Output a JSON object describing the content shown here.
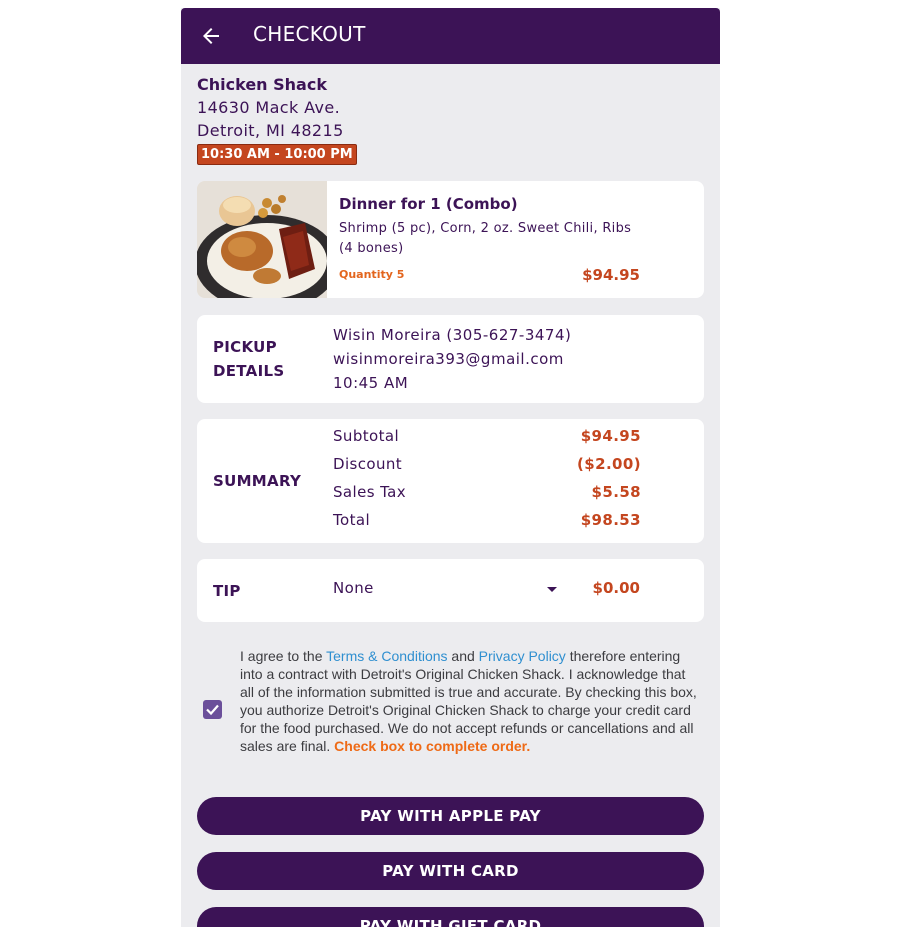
{
  "header": {
    "title": "CHECKOUT",
    "back_icon": "arrow-left-icon"
  },
  "store": {
    "name": "Chicken Shack",
    "address1": "14630 Mack Ave.",
    "address2": "Detroit, MI 48215",
    "hours": "10:30 AM - 10:00 PM"
  },
  "item": {
    "name": "Dinner for 1 (Combo)",
    "description": "Shrimp (5 pc), Corn, 2 oz. Sweet Chili, Ribs (4 bones)",
    "quantity": "Quantity 5",
    "price": "$94.95"
  },
  "pickup": {
    "label_line1": "PICKUP",
    "label_line2": "DETAILS",
    "name_phone": "Wisin Moreira (305-627-3474)",
    "email": "wisinmoreira393@gmail.com",
    "time": "10:45 AM"
  },
  "summary": {
    "label": "SUMMARY",
    "rows": [
      {
        "label": "Subtotal",
        "value": "$94.95"
      },
      {
        "label": "Discount",
        "value": "($2.00)"
      },
      {
        "label": "Sales Tax",
        "value": "$5.58"
      },
      {
        "label": "Total",
        "value": "$98.53"
      }
    ]
  },
  "tip": {
    "label": "TIP",
    "selected": "None",
    "amount": "$0.00"
  },
  "agreement": {
    "text_before": "I agree to the ",
    "terms_link": "Terms & Conditions",
    "and": " and ",
    "privacy_link": "Privacy Policy",
    "text_after": " therefore entering into a contract with Detroit's Original Chicken Shack. I acknowledge that all of the information submitted is true and accurate. By checking this box, you authorize Detroit's Original Chicken Shack to charge your credit card for the food purchased. We do not accept refunds or cancellations and all sales are final. ",
    "warning": "Check box to complete order.",
    "checked": true
  },
  "buttons": {
    "apple_pay": "PAY WITH APPLE PAY",
    "card": "PAY WITH CARD",
    "gift_card": "PAY WITH GIFT CARD"
  },
  "colors": {
    "brand_purple": "#3c1356",
    "price_red": "#c4461f",
    "link_blue": "#2f8fd0",
    "warning_orange": "#ee6a16"
  }
}
